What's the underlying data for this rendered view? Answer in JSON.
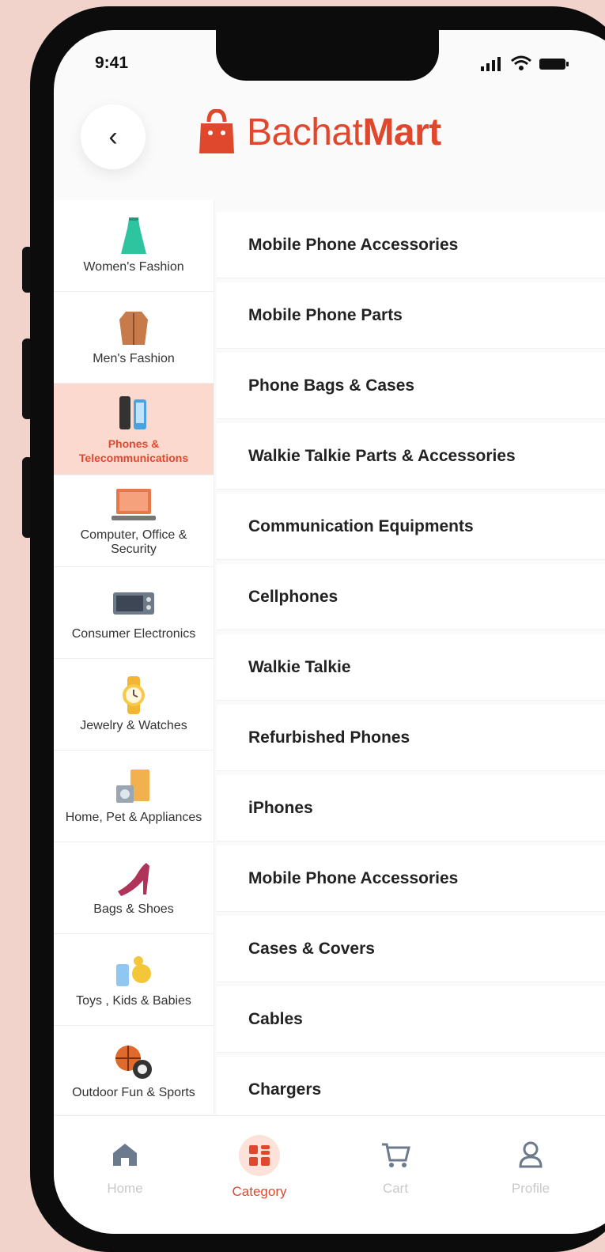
{
  "status": {
    "time": "9:41"
  },
  "brand": {
    "part1": "Bachat",
    "part2": "Mart",
    "color": "#e0482e"
  },
  "categories": [
    {
      "label": "Women's Fashion",
      "icon": "dress-icon"
    },
    {
      "label": "Men's Fashion",
      "icon": "jacket-icon"
    },
    {
      "label": "Phones & Telecommunications",
      "icon": "phone-icon",
      "active": true
    },
    {
      "label": "Computer, Office & Security",
      "icon": "laptop-icon"
    },
    {
      "label": "Consumer Electronics",
      "icon": "oven-icon"
    },
    {
      "label": "Jewelry & Watches",
      "icon": "watch-icon"
    },
    {
      "label": "Home, Pet & Appliances",
      "icon": "appliance-icon"
    },
    {
      "label": "Bags & Shoes",
      "icon": "heel-icon"
    },
    {
      "label": "Toys , Kids & Babies",
      "icon": "toys-icon"
    },
    {
      "label": "Outdoor Fun & Sports",
      "icon": "ball-icon"
    }
  ],
  "subcategories": [
    "Mobile Phone Accessories",
    "Mobile Phone Parts",
    "Phone Bags & Cases",
    "Walkie Talkie Parts & Accessories",
    "Communication Equipments",
    "Cellphones",
    "Walkie Talkie",
    "Refurbished Phones",
    "iPhones",
    "Mobile Phone Accessories",
    "Cases & Covers",
    "Cables",
    "Chargers"
  ],
  "tabs": [
    {
      "label": "Home",
      "icon": "home-icon"
    },
    {
      "label": "Category",
      "icon": "category-icon",
      "active": true
    },
    {
      "label": "Cart",
      "icon": "cart-icon"
    },
    {
      "label": "Profile",
      "icon": "profile-icon"
    }
  ]
}
